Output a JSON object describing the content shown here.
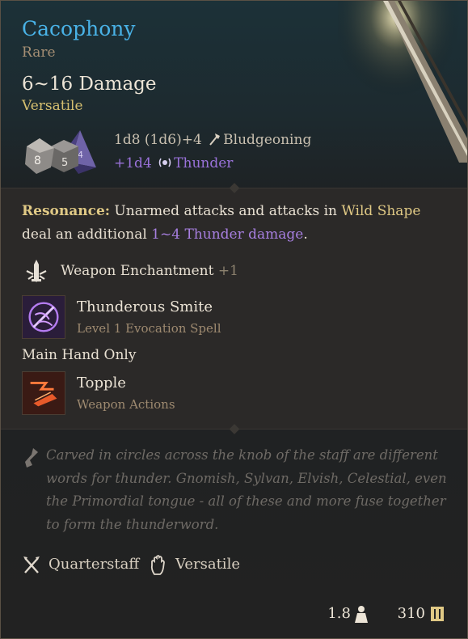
{
  "item": {
    "name": "Cacophony",
    "rarity": "Rare",
    "damage": "6~16 Damage",
    "handedness": "Versatile",
    "damage_roll": "1d8 (1d6)+4",
    "damage_type": "Bludgeoning",
    "bonus_roll": "+1d4",
    "bonus_type": "Thunder",
    "dice_icon": "dice-icon"
  },
  "resonance": {
    "label": "Resonance:",
    "text_before": " Unarmed attacks and attacks in ",
    "wild_shape": "Wild Shape",
    "text_mid": " deal an additional ",
    "damage_hl": "1~4 Thunder damage",
    "text_end": "."
  },
  "enchantment": {
    "label": "Weapon Enchantment",
    "value": "+1",
    "icon": "sword-enchant-icon"
  },
  "spell": {
    "name": "Thunderous Smite",
    "sub": "Level 1 Evocation Spell",
    "icon": "thunderous-smite-icon"
  },
  "main_hand": "Main Hand Only",
  "action": {
    "name": "Topple",
    "sub": "Weapon Actions",
    "icon": "topple-icon"
  },
  "description": "Carved in circles across the knob of the staff are different words for thunder. Gnomish, Sylvan, Elvish, Celestial, even the Primordial tongue - all of these and more fuse together to form the thunderword.",
  "properties": [
    {
      "label": "Quarterstaff",
      "icon": "crossed-staves-icon"
    },
    {
      "label": "Versatile",
      "icon": "hand-icon"
    }
  ],
  "weight": "1.8",
  "price": "310",
  "colors": {
    "title": "#49b2e6",
    "rarity": "#a58f74",
    "gold": "#e0c985",
    "purple": "#a77fe0"
  }
}
